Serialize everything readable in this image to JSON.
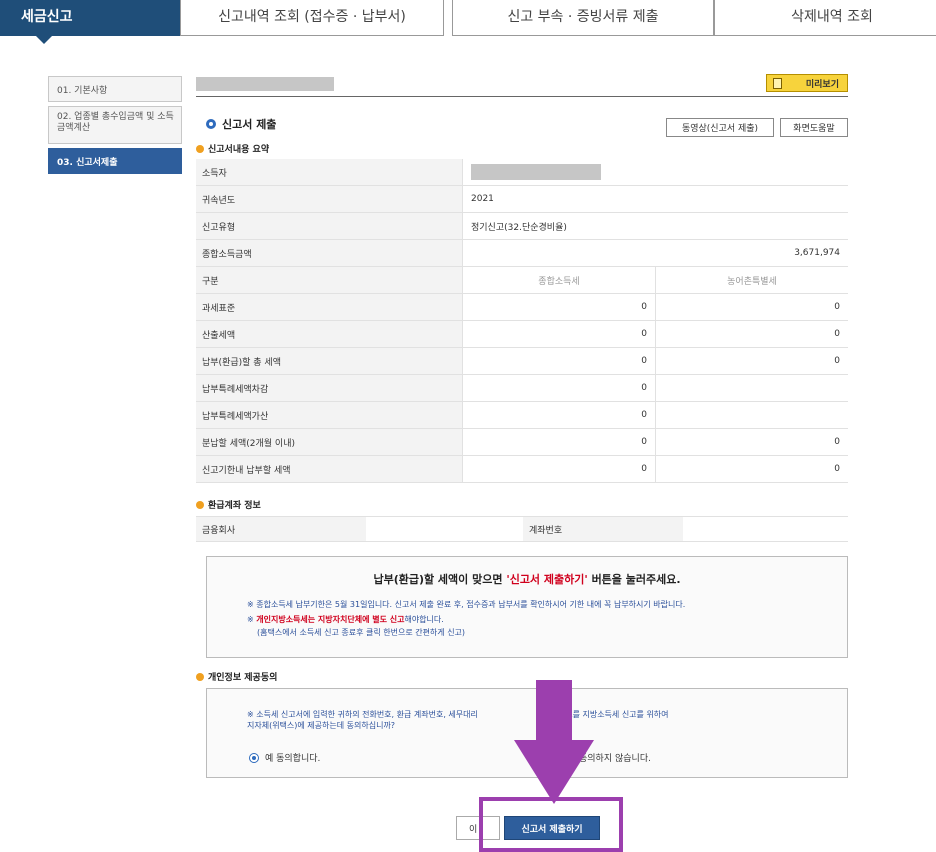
{
  "tabs": [
    {
      "label": "세금신고"
    },
    {
      "label": "신고내역 조회 (접수증 · 납부서)"
    },
    {
      "label": "신고 부속 · 증빙서류 제출"
    },
    {
      "label": "삭제내역 조회"
    }
  ],
  "steps": [
    {
      "label": "01. 기본사항"
    },
    {
      "label": "02. 업종별 총수입금액 및 소득금액계산"
    },
    {
      "label": "03. 신고서제출"
    }
  ],
  "preview_label": "미리보기",
  "section_title": "신고서 제출",
  "video_button": "동영상(신고서 제출)",
  "help_button": "화면도움말",
  "summary_title": "신고서내용 요약",
  "summary": {
    "owner_label": "소득자",
    "year_label": "귀속년도",
    "year_value": "2021",
    "type_label": "신고유형",
    "type_value": "정기신고(32.단순경비율)",
    "income_label": "종합소득금액",
    "income_value": "3,671,974",
    "div_label": "구분",
    "col1": "종합소득세",
    "col2": "농어촌특별세",
    "rows": [
      {
        "label": "과세표준",
        "v1": "0",
        "v2": "0"
      },
      {
        "label": "산출세액",
        "v1": "0",
        "v2": "0"
      },
      {
        "label": "납부(환급)할 총 세액",
        "v1": "0",
        "v2": "0"
      },
      {
        "label": "납부특례세액차감",
        "v1": "0",
        "v2": ""
      },
      {
        "label": "납부특례세액가산",
        "v1": "0",
        "v2": ""
      },
      {
        "label": "분납할 세액(2개월 이내)",
        "v1": "0",
        "v2": "0"
      },
      {
        "label": "신고기한내 납부할 세액",
        "v1": "0",
        "v2": "0"
      }
    ]
  },
  "refund_title": "환급계좌 정보",
  "refund": {
    "bank_label": "금융회사",
    "account_label": "계좌번호"
  },
  "notice": {
    "head_pre": "납부(환급)할 세액이 맞으면 ",
    "head_red": "'신고서 제출하기'",
    "head_post": " 버튼을 눌러주세요.",
    "line1": "※ 종합소득세 납부기한은 5월 31일입니다. 신고서 제출 완료 후, 접수증과 납부서를 확인하시어 기한 내에 꼭 납부하시기 바랍니다.",
    "line2_pre": "※ ",
    "line2_red": "개인지방소득세는 지방자치단체에 별도 신고",
    "line2_post": "해야합니다.",
    "line3": "(홈택스에서 소득세 신고 종료후 클릭 한번으로 간편하게 신고)"
  },
  "consent_title": "개인정보 제공동의",
  "consent": {
    "text1": "※ 소득세 신고서에 입력한 귀하의 전화번호, 환급 계좌번호, 세무대리",
    "text1b": "번호를 지방소득세 신고를 위하여",
    "text2": "지자체(위택스)에 제공하는데 동의하십니까?",
    "agree": "예 동의합니다.",
    "disagree": "동의하지 않습니다."
  },
  "prev_button": "이",
  "submit_button": "신고서 제출하기",
  "colors": {
    "navy": "#1f4e79",
    "step_active": "#2e5e9c",
    "highlight": "#9c3fae",
    "arrow": "#9c3fae"
  }
}
